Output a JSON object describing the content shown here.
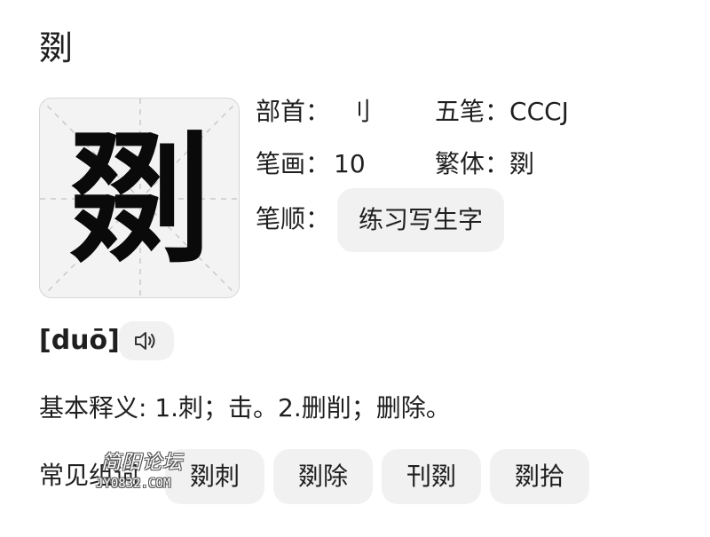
{
  "header": {
    "title": "剟"
  },
  "character": {
    "glyph": "剟"
  },
  "info": {
    "radical_label": "部首：",
    "radical_value": "刂",
    "wubi_label": "五笔：",
    "wubi_value": "CCCJ",
    "strokes_label": "笔画：",
    "strokes_value": "10",
    "traditional_label": "繁体：",
    "traditional_value": "剟",
    "stroke_order_label": "笔顺：",
    "practice_button": "练习写生字"
  },
  "pronunciation": {
    "pinyin": "[duō]",
    "audio_icon": "speaker-icon"
  },
  "definition": {
    "text": "基本释义: 1.刺；击。2.删削；删除。"
  },
  "words": {
    "label": "常见组词",
    "items": [
      "剟刺",
      "剟除",
      "刊剟",
      "剟拾"
    ]
  },
  "watermark": {
    "line1": "简阳论坛",
    "line2": "JY0832.COM"
  }
}
